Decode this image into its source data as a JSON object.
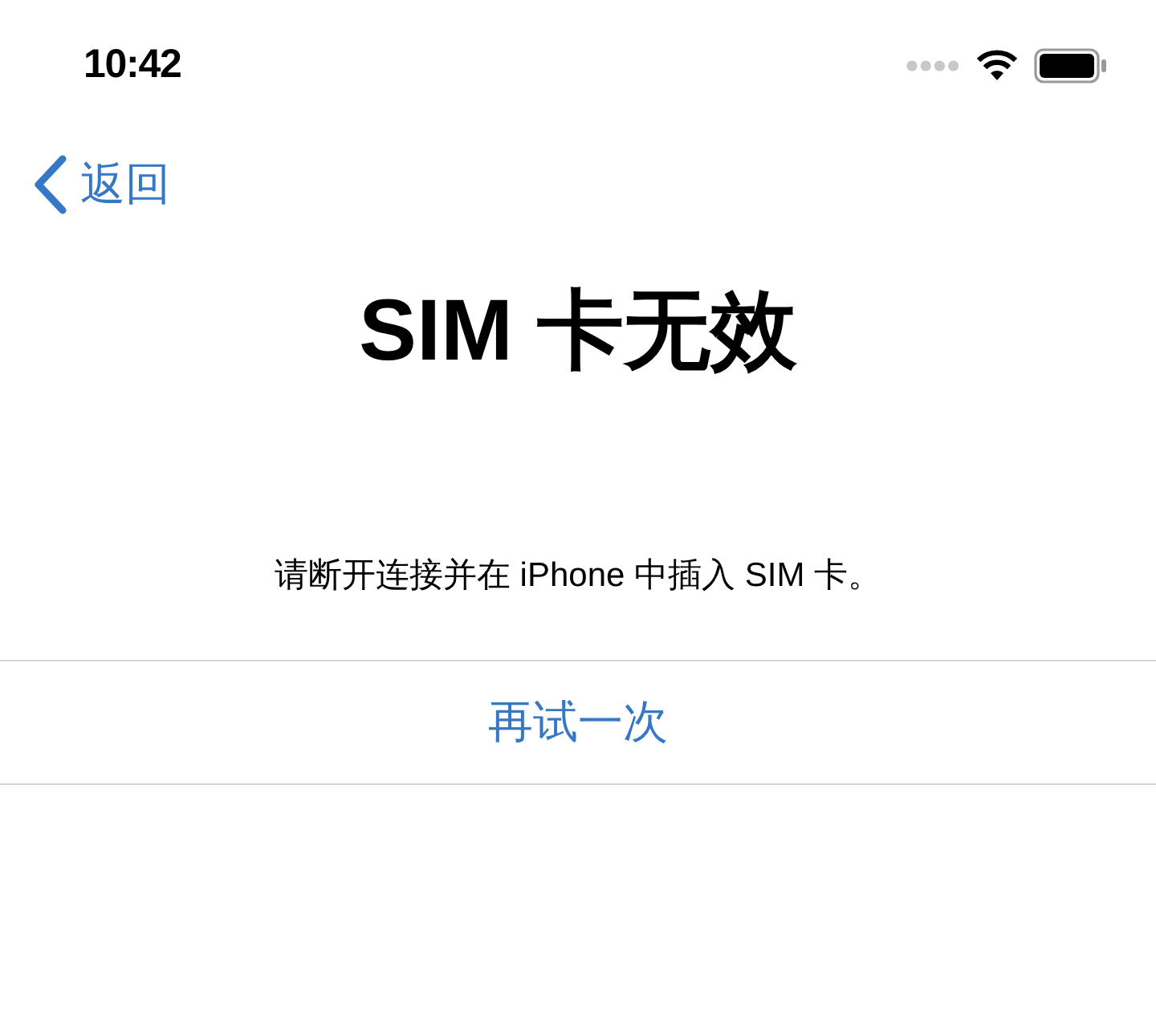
{
  "status_bar": {
    "time": "10:42"
  },
  "nav": {
    "back_label": "返回"
  },
  "title": "SIM 卡无效",
  "message": "请断开连接并在 iPhone 中插入 SIM 卡。",
  "action_button": "再试一次"
}
